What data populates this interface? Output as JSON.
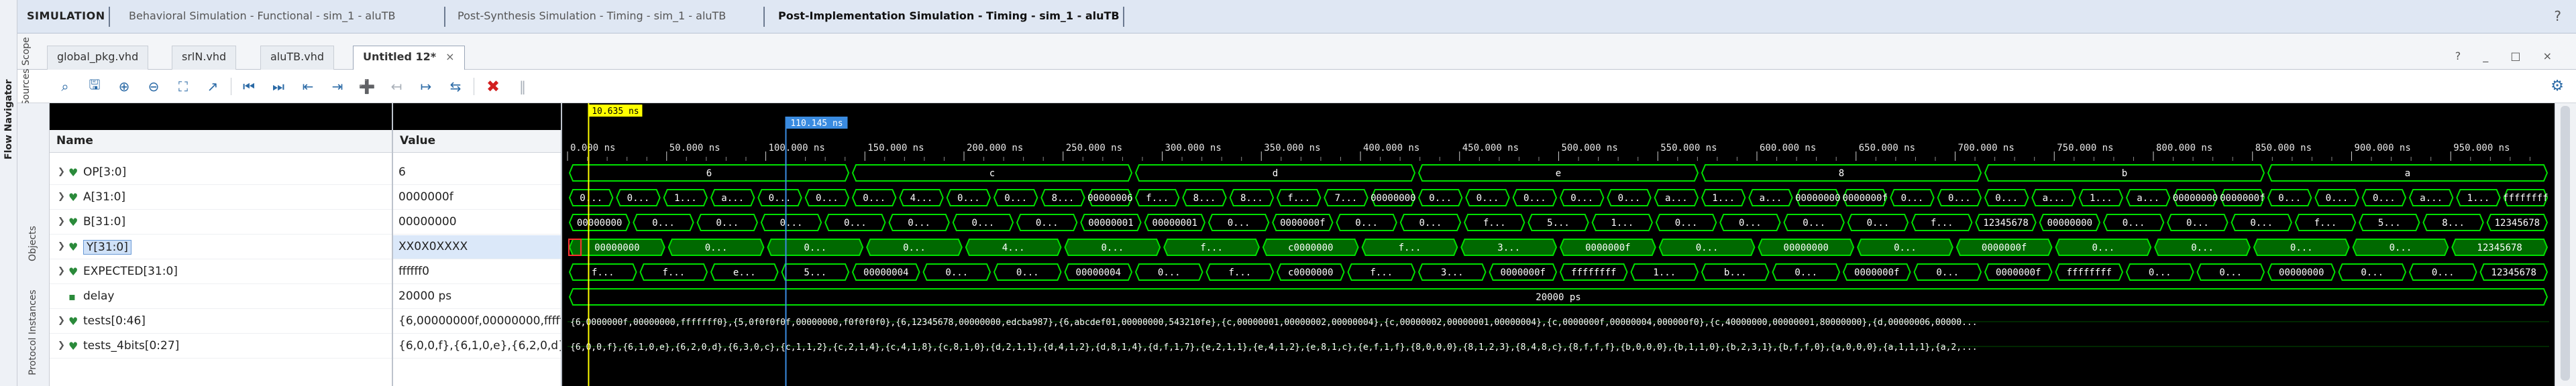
{
  "left_strip": {
    "flow_navigator": "Flow Navigator",
    "sources": "Sources",
    "scope": "Scope",
    "objects": "Objects",
    "protocol_instances": "Protocol Instances"
  },
  "sim_bar": {
    "title": "SIMULATION",
    "links": [
      {
        "label": "Behavioral Simulation - Functional - sim_1 - aluTB"
      },
      {
        "label": "Post-Synthesis Simulation - Timing - sim_1 - aluTB"
      },
      {
        "label": "Post-Implementation Simulation - Timing - sim_1 - aluTB"
      }
    ],
    "help": "?"
  },
  "tabs": [
    {
      "label": "global_pkg.vhd"
    },
    {
      "label": "srlN.vhd"
    },
    {
      "label": "aluTB.vhd"
    },
    {
      "label": "Untitled 12*"
    }
  ],
  "tab_close": "×",
  "window_controls": "? _ □ ×",
  "toolbar": {
    "icons": [
      "search-icon",
      "save-icon",
      "zoom-in-icon",
      "zoom-out-icon",
      "zoom-fit-icon",
      "cursor-snap-icon",
      "go-to-start-icon",
      "go-to-end-icon",
      "previous-transition-icon",
      "next-transition-icon",
      "add-marker-icon",
      "previous-marker-icon",
      "next-marker-icon",
      "swap-cursors-icon",
      "snap-to-transition-icon",
      "stop-icon",
      "pause-icon"
    ],
    "settings_icon": "gear-icon"
  },
  "waves": {
    "name_header": "Name",
    "value_header": "Value",
    "cursor_primary": "10.635 ns",
    "cursor_secondary": "110.145 ns",
    "time_ticks": [
      "0.000 ns",
      "50.000 ns",
      "100.000 ns",
      "150.000 ns",
      "200.000 ns",
      "250.000 ns",
      "300.000 ns",
      "350.000 ns",
      "400.000 ns",
      "450.000 ns",
      "500.000 ns",
      "550.000 ns",
      "600.000 ns",
      "650.000 ns",
      "700.000 ns",
      "750.000 ns",
      "800.000 ns",
      "850.000 ns",
      "900.000 ns",
      "950.000 ns"
    ],
    "signals": [
      {
        "name": "OP[3:0]",
        "value": "6",
        "expandable": true
      },
      {
        "name": "A[31:0]",
        "value": "0000000f",
        "expandable": true
      },
      {
        "name": "B[31:0]",
        "value": "00000000",
        "expandable": true
      },
      {
        "name": "Y[31:0]",
        "value": "XX0X0XXXX",
        "expandable": true
      },
      {
        "name": "EXPECTED[31:0]",
        "value": "ffffff0",
        "expandable": true
      },
      {
        "name": "delay",
        "value": "20000 ps",
        "expandable": false
      },
      {
        "name": "tests[0:46]",
        "value": "{6,00000000f,00000000,ffffffff0}",
        "expandable": true
      },
      {
        "name": "tests_4bits[0:27]",
        "value": "{6,0,0,f},{6,1,0,e},{6,2,0,d},{6,3,0,c}",
        "expandable": true
      }
    ],
    "segments": {
      "op": [
        "6",
        "c",
        "d",
        "e",
        "8",
        "b",
        "a"
      ],
      "a": [
        "0...",
        "0...",
        "1...",
        "a...",
        "0...",
        "0...",
        "0...",
        "4...",
        "0...",
        "0...",
        "8...",
        "00000006",
        "f...",
        "8...",
        "8...",
        "f...",
        "7...",
        "00000000",
        "0...",
        "0...",
        "0...",
        "0...",
        "0...",
        "a...",
        "1...",
        "a...",
        "00000000",
        "0000000f",
        "0...",
        "0...",
        "0...",
        "a...",
        "1...",
        "a...",
        "00000000",
        "0000000f",
        "0...",
        "0...",
        "0...",
        "a...",
        "1...",
        "ffffffff"
      ],
      "b": [
        "00000000",
        "0...",
        "0...",
        "0...",
        "0...",
        "0...",
        "0...",
        "0...",
        "00000001",
        "00000001",
        "0...",
        "0000000f",
        "0...",
        "0...",
        "f...",
        "5...",
        "1...",
        "0...",
        "0...",
        "0...",
        "0...",
        "f...",
        "12345678",
        "00000000",
        "0...",
        "0...",
        "0...",
        "f...",
        "5...",
        "8...",
        "12345678"
      ],
      "y": [
        "00000000",
        "0...",
        "0...",
        "0...",
        "4...",
        "0...",
        "f...",
        "c0000000",
        "f...",
        "3...",
        "0000000f",
        "0...",
        "00000000",
        "0...",
        "0000000f",
        "0...",
        "0...",
        "0...",
        "0...",
        "12345678"
      ],
      "expected": [
        "f...",
        "f...",
        "e...",
        "5...",
        "00000004",
        "0...",
        "0...",
        "00000004",
        "0...",
        "f...",
        "c0000000",
        "f...",
        "3...",
        "0000000f",
        "ffffffff",
        "1...",
        "b...",
        "0...",
        "0000000f",
        "0...",
        "0000000f",
        "ffffffff",
        "0...",
        "0...",
        "00000000",
        "0...",
        "0...",
        "12345678"
      ],
      "delay": "20000 ps",
      "tests": "{6,0000000f,00000000,fffffff0},{5,0f0f0f0f,00000000,f0f0f0f0},{6,12345678,00000000,edcba987},{6,abcdef01,00000000,543210fe},{c,00000001,00000002,00000004},{c,00000002,00000001,00000004},{c,0000000f,00000004,000000f0},{c,40000000,00000001,80000000},{d,00000006,00000...",
      "tests_4bits": "{6,0,0,f},{6,1,0,e},{6,2,0,d},{6,3,0,c},{c,1,1,2},{c,2,1,4},{c,4,1,8},{c,8,1,0},{d,2,1,1},{d,4,1,2},{d,8,1,4},{d,f,1,7},{e,2,1,1},{e,4,1,2},{e,8,1,c},{e,f,1,f},{8,0,0,0},{8,1,2,3},{8,4,8,c},{8,f,f,f},{b,0,0,0},{b,1,1,0},{b,2,3,1},{b,f,f,0},{a,0,0,0},{a,1,1,1},{a,2,..."
    }
  },
  "colors": {
    "wave": "#00e000",
    "wave_fill": "#00c000",
    "cursor_primary": "#ffff00",
    "cursor_secondary": "#3a8be0",
    "error": "#ff3030"
  }
}
